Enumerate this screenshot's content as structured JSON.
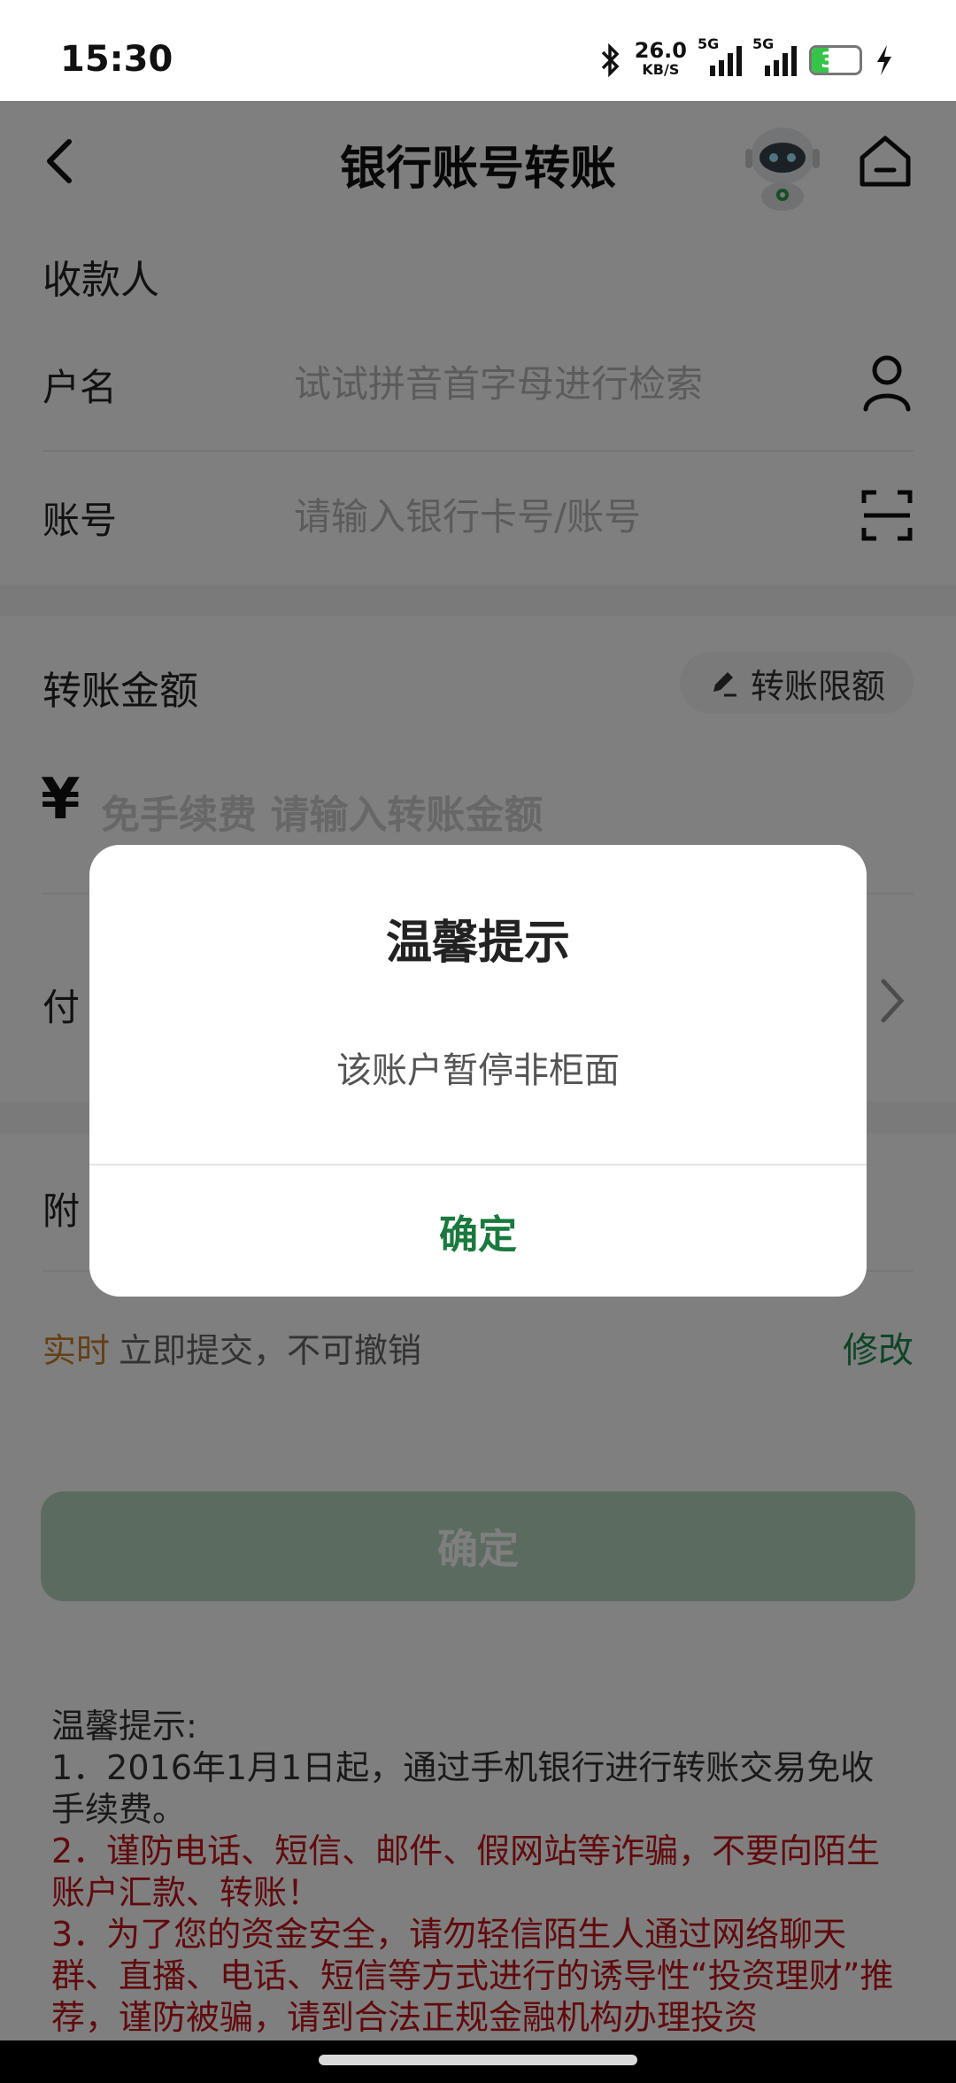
{
  "status_bar": {
    "time": "15:30",
    "net_speed": "26.0",
    "net_speed_unit": "KB/S",
    "signal_1_label": "5G",
    "signal_2_label": "5G",
    "battery": "35",
    "battery_level": 0.35,
    "icons": [
      "bluetooth-icon",
      "signal-icon",
      "signal-icon",
      "battery-icon",
      "charging-icon"
    ]
  },
  "header": {
    "title": "银行账号转账"
  },
  "payee": {
    "section_label": "收款人",
    "name_label": "户名",
    "name_placeholder": "试试拼音首字母进行检索",
    "account_label": "账号",
    "account_placeholder": "请输入银行卡号/账号"
  },
  "amount": {
    "section_label": "转账金额",
    "limit_button": "转账限额",
    "currency_symbol": "¥",
    "placeholder": "免手续费 请输入转账金额"
  },
  "payer": {
    "label_partial": "付"
  },
  "note": {
    "label_partial": "附"
  },
  "timing": {
    "mode": "实时",
    "description": "立即提交，不可撤销",
    "modify": "修改"
  },
  "confirm_button": "确定",
  "tips": {
    "title": "温馨提示:",
    "item1": "1．2016年1月1日起，通过手机银行进行转账交易免收手续费。",
    "item2": "2．谨防电话、短信、邮件、假网站等诈骗，不要向陌生账户汇款、转账！",
    "item3": "3．为了您的资金安全，请勿轻信陌生人通过网络聊天群、直播、电话、短信等方式进行的诱导性“投资理财”推荐，谨防被骗，请到合法正规金融机构办理投资"
  },
  "dialog": {
    "title": "温馨提示",
    "message": "该账户暂停非柜面",
    "ok_button": "确定"
  },
  "colors": {
    "accent_green": "#1a7a3e",
    "realtime_orange": "#c9812a",
    "warning_red": "#c2141c",
    "disabled_button": "#b8d7c0"
  }
}
